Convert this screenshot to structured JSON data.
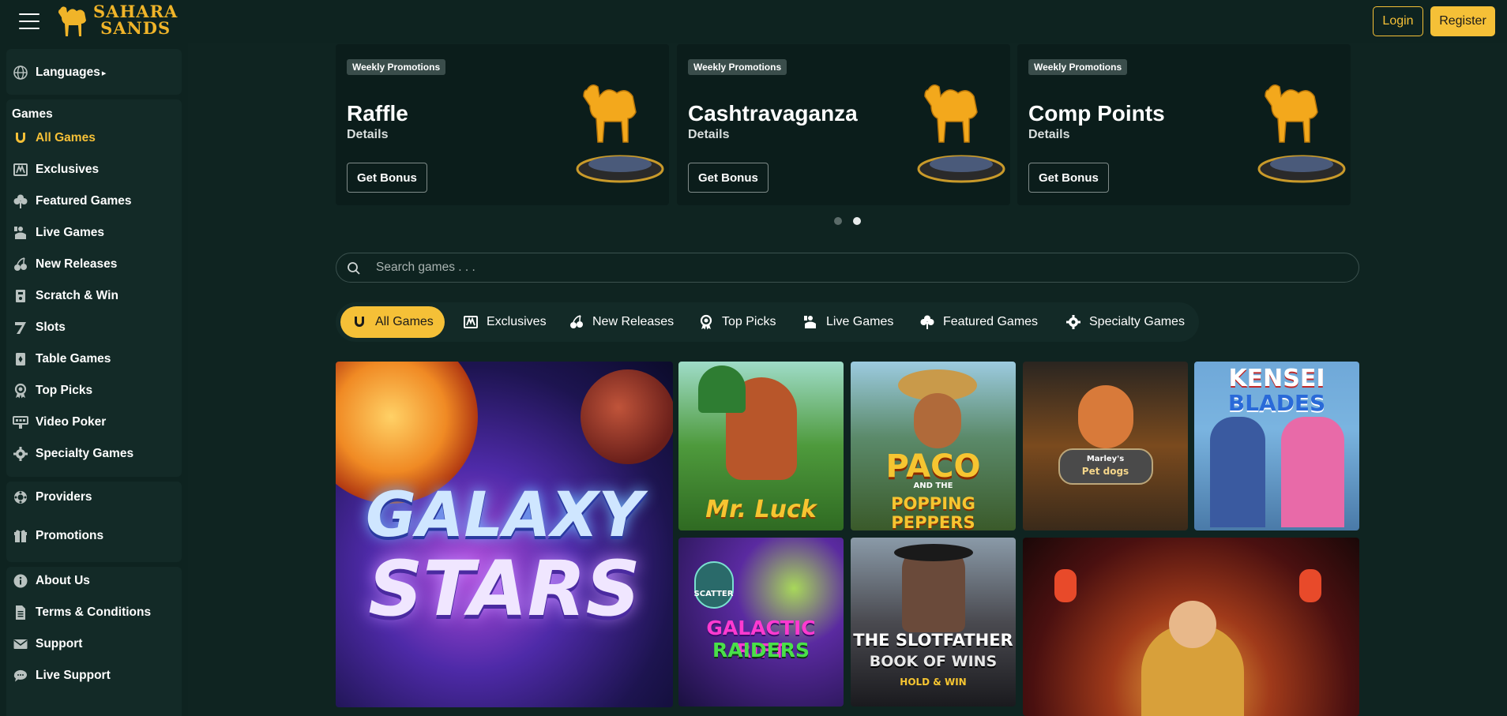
{
  "header": {
    "logo_text_line1": "SAHARA",
    "logo_text_line2": "SANDS",
    "login_label": "Login",
    "register_label": "Register",
    "accent_color": "#f5c037"
  },
  "sidebar": {
    "languages_label": "Languages",
    "games_heading": "Games",
    "game_items": [
      {
        "label": "All Games",
        "icon": "horseshoe-icon",
        "active": true
      },
      {
        "label": "Exclusives",
        "icon": "exclusives-icon",
        "active": false
      },
      {
        "label": "Featured Games",
        "icon": "clover-icon",
        "active": false
      },
      {
        "label": "Live Games",
        "icon": "live-dealer-icon",
        "active": false
      },
      {
        "label": "New Releases",
        "icon": "cherries-icon",
        "active": false
      },
      {
        "label": "Scratch & Win",
        "icon": "scratch-ticket-icon",
        "active": false
      },
      {
        "label": "Slots",
        "icon": "seven-icon",
        "active": false
      },
      {
        "label": "Table Games",
        "icon": "cards-icon",
        "active": false
      },
      {
        "label": "Top Picks",
        "icon": "award-icon",
        "active": false
      },
      {
        "label": "Video Poker",
        "icon": "poker-machine-icon",
        "active": false
      },
      {
        "label": "Specialty Games",
        "icon": "gear-icon",
        "active": false
      }
    ],
    "providers_label": "Providers",
    "promotions_label": "Promotions",
    "info_items": [
      {
        "label": "About Us",
        "icon": "info-icon"
      },
      {
        "label": "Terms & Conditions",
        "icon": "document-icon"
      },
      {
        "label": "Support",
        "icon": "envelope-icon"
      },
      {
        "label": "Live Support",
        "icon": "chat-icon"
      }
    ]
  },
  "promotions": [
    {
      "badge": "Weekly Promotions",
      "title": "Raffle",
      "details": "Details",
      "button": "Get Bonus"
    },
    {
      "badge": "Weekly Promotions",
      "title": "Cashtravaganza",
      "details": "Details",
      "button": "Get Bonus"
    },
    {
      "badge": "Weekly Promotions",
      "title": "Comp Points",
      "details": "Details",
      "button": "Get Bonus"
    }
  ],
  "carousel": {
    "pages": 2,
    "active_page": 2
  },
  "search": {
    "placeholder": "Search games . . ."
  },
  "tabs": [
    {
      "label": "All Games",
      "icon": "horseshoe-icon",
      "active": true
    },
    {
      "label": "Exclusives",
      "icon": "exclusives-icon",
      "active": false
    },
    {
      "label": "New Releases",
      "icon": "cherries-icon",
      "active": false
    },
    {
      "label": "Top Picks",
      "icon": "award-icon",
      "active": false
    },
    {
      "label": "Live Games",
      "icon": "live-dealer-icon",
      "active": false
    },
    {
      "label": "Featured Games",
      "icon": "clover-icon",
      "active": false
    },
    {
      "label": "Specialty Games",
      "icon": "gear-icon",
      "active": false
    }
  ],
  "games": [
    {
      "title_line1": "GALAXY",
      "title_line2": "STARS"
    },
    {
      "title_line1": "Mr. Luck",
      "title_line2": ""
    },
    {
      "title_line1": "PACO",
      "title_line2": "POPPING PEPPERS",
      "small": "AND THE"
    },
    {
      "title_line1": "Marley's",
      "title_line2": "Pet dogs"
    },
    {
      "title_line1": "KENSEI",
      "title_line2": "BLADES"
    },
    {
      "title_line1": "GALACTIC RIFT",
      "title_line2": "RAIDERS",
      "small": "SCATTER"
    },
    {
      "title_line1": "THE SLOTFATHER",
      "title_line2": "BOOK OF WINS",
      "small": "HOLD & WIN"
    },
    {
      "title_line1": "",
      "title_line2": ""
    }
  ]
}
